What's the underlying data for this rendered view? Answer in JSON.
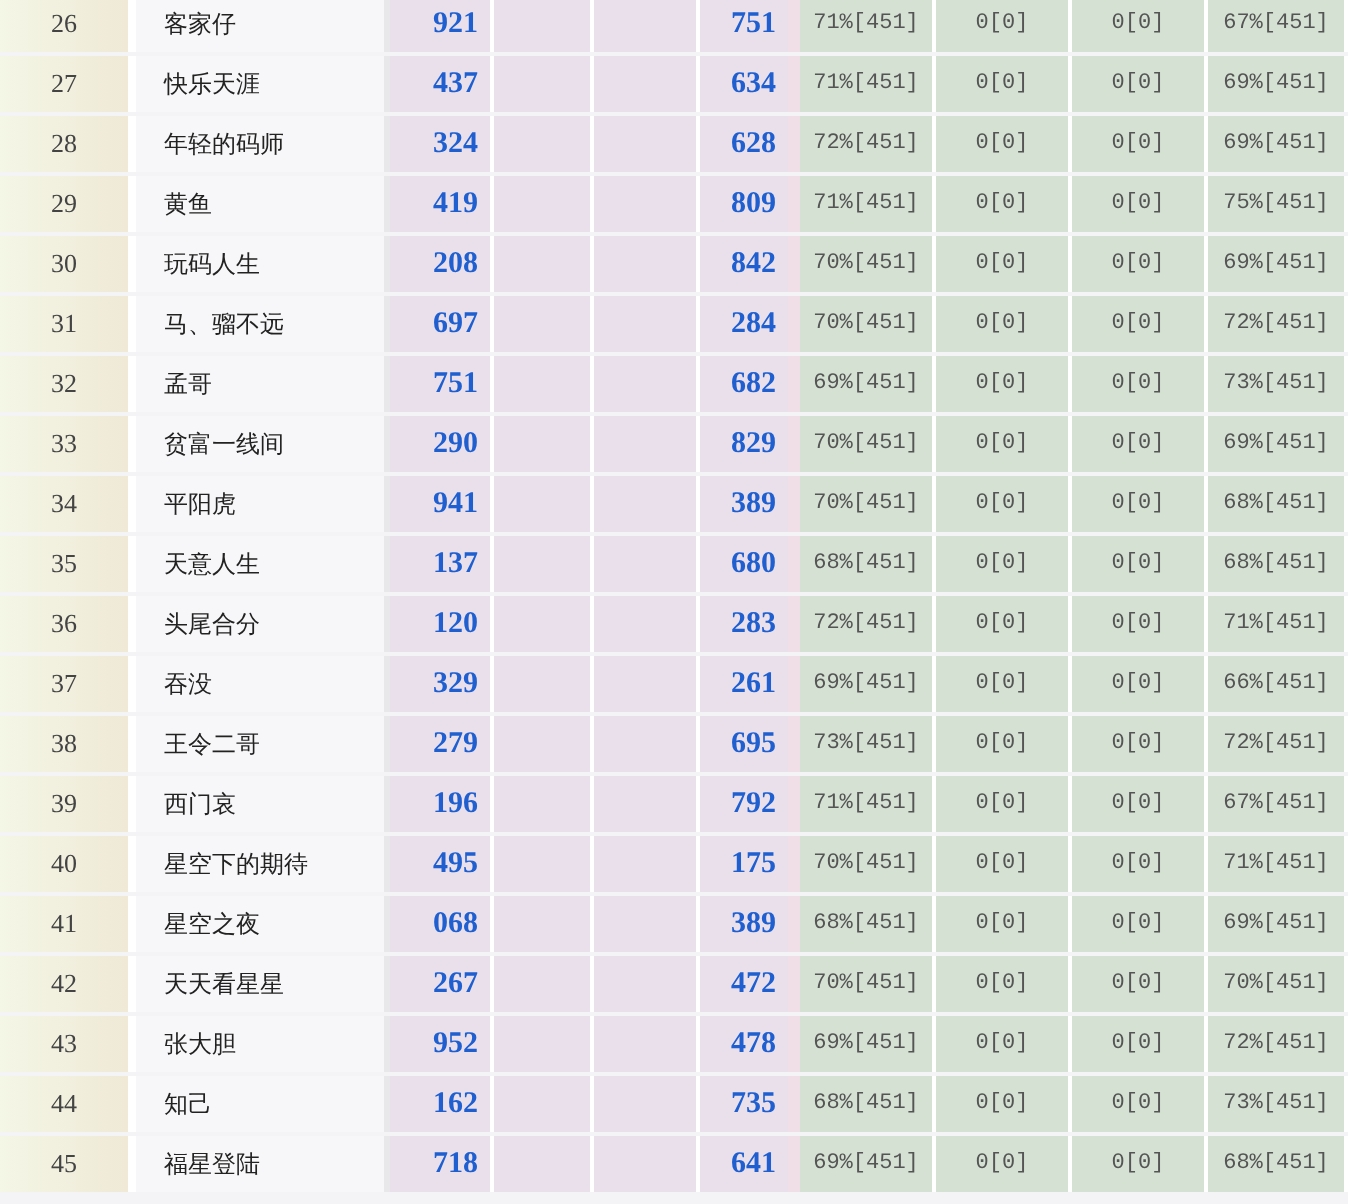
{
  "table": {
    "rows": [
      {
        "column_1": "26",
        "column_2": "客家仔",
        "column_3": "921",
        "column_6": "751",
        "column_7": "71%[451]",
        "column_8": "0[0]",
        "column_9": "0[0]",
        "column_10": "67%[451]"
      },
      {
        "column_1": "27",
        "column_2": "快乐天涯",
        "column_3": "437",
        "column_6": "634",
        "column_7": "71%[451]",
        "column_8": "0[0]",
        "column_9": "0[0]",
        "column_10": "69%[451]"
      },
      {
        "column_1": "28",
        "column_2": "年轻的码师",
        "column_3": "324",
        "column_6": "628",
        "column_7": "72%[451]",
        "column_8": "0[0]",
        "column_9": "0[0]",
        "column_10": "69%[451]"
      },
      {
        "column_1": "29",
        "column_2": "黄鱼",
        "column_3": "419",
        "column_6": "809",
        "column_7": "71%[451]",
        "column_8": "0[0]",
        "column_9": "0[0]",
        "column_10": "75%[451]"
      },
      {
        "column_1": "30",
        "column_2": "玩码人生",
        "column_3": "208",
        "column_6": "842",
        "column_7": "70%[451]",
        "column_8": "0[0]",
        "column_9": "0[0]",
        "column_10": "69%[451]"
      },
      {
        "column_1": "31",
        "column_2": "马、骝不远",
        "column_3": "697",
        "column_6": "284",
        "column_7": "70%[451]",
        "column_8": "0[0]",
        "column_9": "0[0]",
        "column_10": "72%[451]"
      },
      {
        "column_1": "32",
        "column_2": "孟哥",
        "column_3": "751",
        "column_6": "682",
        "column_7": "69%[451]",
        "column_8": "0[0]",
        "column_9": "0[0]",
        "column_10": "73%[451]"
      },
      {
        "column_1": "33",
        "column_2": "贫富一线间",
        "column_3": "290",
        "column_6": "829",
        "column_7": "70%[451]",
        "column_8": "0[0]",
        "column_9": "0[0]",
        "column_10": "69%[451]"
      },
      {
        "column_1": "34",
        "column_2": "平阳虎",
        "column_3": "941",
        "column_6": "389",
        "column_7": "70%[451]",
        "column_8": "0[0]",
        "column_9": "0[0]",
        "column_10": "68%[451]"
      },
      {
        "column_1": "35",
        "column_2": "天意人生",
        "column_3": "137",
        "column_6": "680",
        "column_7": "68%[451]",
        "column_8": "0[0]",
        "column_9": "0[0]",
        "column_10": "68%[451]"
      },
      {
        "column_1": "36",
        "column_2": "头尾合分",
        "column_3": "120",
        "column_6": "283",
        "column_7": "72%[451]",
        "column_8": "0[0]",
        "column_9": "0[0]",
        "column_10": "71%[451]"
      },
      {
        "column_1": "37",
        "column_2": "吞没",
        "column_3": "329",
        "column_6": "261",
        "column_7": "69%[451]",
        "column_8": "0[0]",
        "column_9": "0[0]",
        "column_10": "66%[451]"
      },
      {
        "column_1": "38",
        "column_2": "王令二哥",
        "column_3": "279",
        "column_6": "695",
        "column_7": "73%[451]",
        "column_8": "0[0]",
        "column_9": "0[0]",
        "column_10": "72%[451]"
      },
      {
        "column_1": "39",
        "column_2": "西门哀",
        "column_3": "196",
        "column_6": "792",
        "column_7": "71%[451]",
        "column_8": "0[0]",
        "column_9": "0[0]",
        "column_10": "67%[451]"
      },
      {
        "column_1": "40",
        "column_2": "星空下的期待",
        "column_3": "495",
        "column_6": "175",
        "column_7": "70%[451]",
        "column_8": "0[0]",
        "column_9": "0[0]",
        "column_10": "71%[451]"
      },
      {
        "column_1": "41",
        "column_2": "星空之夜",
        "column_3": "068",
        "column_6": "389",
        "column_7": "68%[451]",
        "column_8": "0[0]",
        "column_9": "0[0]",
        "column_10": "69%[451]"
      },
      {
        "column_1": "42",
        "column_2": "天天看星星",
        "column_3": "267",
        "column_6": "472",
        "column_7": "70%[451]",
        "column_8": "0[0]",
        "column_9": "0[0]",
        "column_10": "70%[451]"
      },
      {
        "column_1": "43",
        "column_2": "张大胆",
        "column_3": "952",
        "column_6": "478",
        "column_7": "69%[451]",
        "column_8": "0[0]",
        "column_9": "0[0]",
        "column_10": "72%[451]"
      },
      {
        "column_1": "44",
        "column_2": "知己",
        "column_3": "162",
        "column_6": "735",
        "column_7": "68%[451]",
        "column_8": "0[0]",
        "column_9": "0[0]",
        "column_10": "73%[451]"
      },
      {
        "column_1": "45",
        "column_2": "福星登陆",
        "column_3": "718",
        "column_6": "641",
        "column_7": "69%[451]",
        "column_8": "0[0]",
        "column_9": "0[0]",
        "column_10": "68%[451]"
      }
    ]
  }
}
